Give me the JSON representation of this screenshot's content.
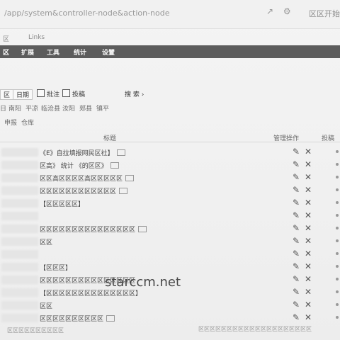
{
  "browser": {
    "url": "/app/system&controller-node&action-node",
    "right_label": "区区开始区"
  },
  "links": {
    "item1": "区",
    "item2": "Links"
  },
  "nav": {
    "items": [
      "区",
      "扩展",
      "工具",
      "统计",
      "设置"
    ]
  },
  "toolbar": {
    "select1": "区",
    "select2": "日期",
    "check1": "批注",
    "check2": "投稿",
    "search": "搜 索 ›"
  },
  "filters": [
    "日",
    "南阳",
    "平凉",
    "临沧县",
    "汝阳",
    "郏县",
    "镇平"
  ],
  "filters2": [
    "申报",
    "仓库"
  ],
  "table": {
    "col_title": "标题",
    "col_manage": "管理操作",
    "col_post": "投稿"
  },
  "rows": [
    {
      "title": "《E》自拉填报网民区社】"
    },
    {
      "title": "区高》 统计 《的区区》"
    },
    {
      "title": "区区高区区区区高区区区区区"
    },
    {
      "title": "区区区区区区区区区区区区"
    },
    {
      "title": "【区区区区区】"
    },
    {
      "title": ""
    },
    {
      "title": "区区区区区区区区区区区区区区区"
    },
    {
      "title": "区区"
    },
    {
      "title": ""
    },
    {
      "title": "【区区区】"
    },
    {
      "title": "区区区区区区区区区区区区区区区"
    },
    {
      "title": "【区区区区区区区区区区区区区区】"
    },
    {
      "title": "区区"
    },
    {
      "title": "区区区区区区区区区区"
    },
    {
      "title": "区区"
    },
    {
      "title": "区区区区区区区区区区区区区区区"
    },
    {
      "title": ""
    }
  ],
  "bottom": {
    "left": "区区区区区区区区区区",
    "right": "区区区区区区区区区区区区区区区区区区区区"
  },
  "watermark": "starccm.net"
}
